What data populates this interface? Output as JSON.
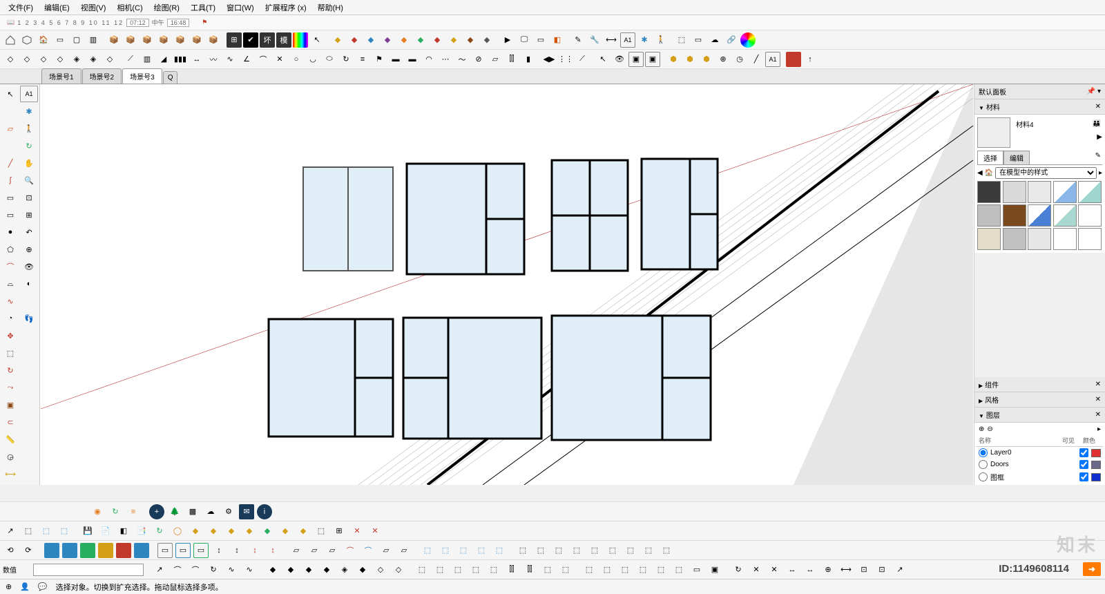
{
  "menu": {
    "file": "文件(F)",
    "edit": "编辑(E)",
    "view": "视图(V)",
    "camera": "相机(C)",
    "draw": "绘图(R)",
    "tools": "工具(T)",
    "window": "窗口(W)",
    "extensions": "扩展程序 (x)",
    "help": "帮助(H)"
  },
  "timeline": {
    "ticks": "1 2 3 4 5 6 7 8 9 10 11 12",
    "time1": "07:12",
    "mid": "中午",
    "time2": "16:48"
  },
  "tabs": {
    "t1": "场景号1",
    "t2": "场景号2",
    "t3": "场景号3",
    "q": "Q"
  },
  "toolbar_text": {
    "huai": "坏",
    "mo": "模"
  },
  "right": {
    "default_panel": "默认面板",
    "materials": "材料",
    "material_name": "材料4",
    "select": "选择",
    "edit": "编辑",
    "dropdown": "在模型中的样式",
    "components": "组件",
    "styles": "风格",
    "layers": "图层",
    "name_hdr": "名称",
    "visible_hdr": "可见",
    "color_hdr": "颜色",
    "layer0": "Layer0",
    "layer1": "Doors",
    "layer2": "图框"
  },
  "swatches": [
    "#3a3a3a",
    "#d9d9d9",
    "#e8e8e8",
    "linear-gradient(135deg,#fff 50%,#8ab6e8 50%)",
    "linear-gradient(135deg,#fff 50%,#9fd6d0 50%)",
    "#bfbfbf",
    "#7a4a1e",
    "linear-gradient(135deg,#fff 50%,#4a7fd6 50%)",
    "linear-gradient(135deg,#fff 50%,#a8d8d0 50%)",
    "#ffffff",
    "#e3dcc8",
    "#c0c0c0",
    "#e6e6e6",
    "#ffffff",
    "#ffffff"
  ],
  "layer_colors": [
    "#e03030",
    "#6a6a8a",
    "#1030d0"
  ],
  "status": {
    "value_label": "数值",
    "hint": "选择对象。切换到扩充选择。拖动鼠标选择多项。"
  },
  "footer": {
    "id_label": "ID:",
    "id": "1149608114",
    "brand": "知末"
  }
}
